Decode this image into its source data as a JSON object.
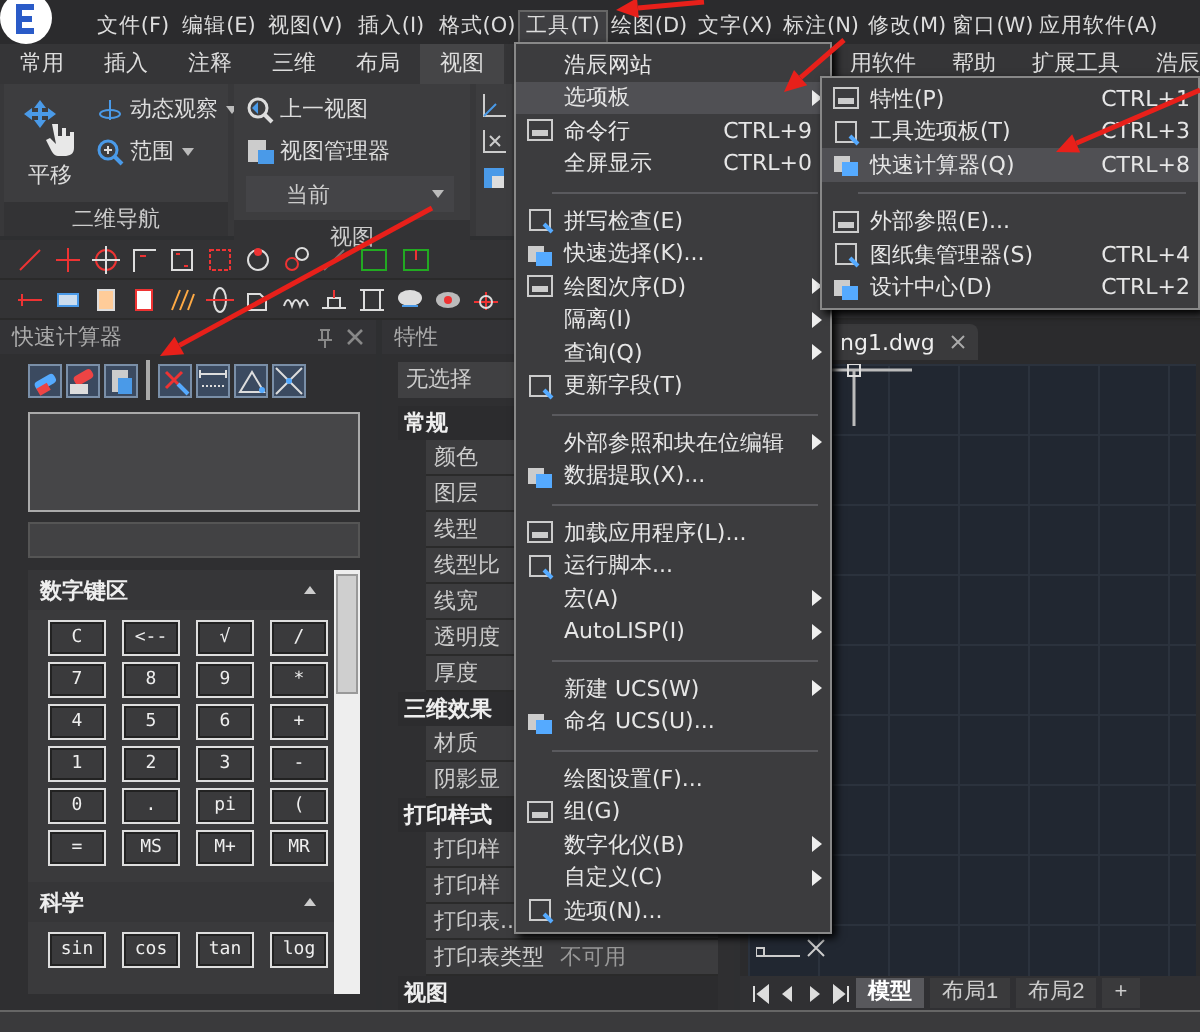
{
  "menubar": {
    "items": [
      {
        "label": "文件(F)",
        "selected": false
      },
      {
        "label": "编辑(E)",
        "selected": false
      },
      {
        "label": "视图(V)",
        "selected": false
      },
      {
        "label": "插入(I)",
        "selected": false
      },
      {
        "label": "格式(O)",
        "selected": false
      },
      {
        "label": "工具(T)",
        "selected": true
      },
      {
        "label": "绘图(D)",
        "selected": false
      },
      {
        "label": "文字(X)",
        "selected": false
      },
      {
        "label": "标注(N)",
        "selected": false
      },
      {
        "label": "修改(M)",
        "selected": false
      },
      {
        "label": "窗口(W)",
        "selected": false
      },
      {
        "label": "应用软件(A)",
        "selected": false
      }
    ]
  },
  "ribbon": {
    "tabs": [
      {
        "label": "常用",
        "selected": false
      },
      {
        "label": "插入",
        "selected": false
      },
      {
        "label": "注释",
        "selected": false
      },
      {
        "label": "三维",
        "selected": false
      },
      {
        "label": "布局",
        "selected": false
      },
      {
        "label": "视图",
        "selected": true
      }
    ],
    "tabs_right": [
      {
        "label": "用软件",
        "selected": false
      },
      {
        "label": "帮助",
        "selected": false
      },
      {
        "label": "扩展工具",
        "selected": false
      },
      {
        "label": "浩辰",
        "selected": false
      }
    ],
    "nav_group": {
      "title": "二维导航",
      "pan": "平移",
      "orbit": "动态观察",
      "extents": "范围"
    },
    "view_group": {
      "title": "视图",
      "previous": "上一视图",
      "manager": "视图管理器",
      "view_select": "当前"
    }
  },
  "calculator": {
    "title": "快速计算器",
    "keypad": {
      "title": "数字键区",
      "keys": [
        "C",
        "<--",
        "√",
        "/",
        "7",
        "8",
        "9",
        "*",
        "4",
        "5",
        "6",
        "+",
        "1",
        "2",
        "3",
        "-",
        "0",
        ".",
        "pi",
        "(",
        "=",
        "MS",
        "M+",
        "MR"
      ]
    },
    "scientific": {
      "title": "科学",
      "keys": [
        "sin",
        "cos",
        "tan",
        "log"
      ]
    }
  },
  "properties": {
    "title": "特性",
    "selection": "无选择",
    "sections": [
      {
        "title": "常规",
        "items": [
          {
            "label": "颜色"
          },
          {
            "label": "图层"
          },
          {
            "label": "线型"
          },
          {
            "label": "线型比"
          },
          {
            "label": "线宽"
          },
          {
            "label": "透明度"
          },
          {
            "label": "厚度"
          }
        ]
      },
      {
        "title": "三维效果",
        "items": [
          {
            "label": "材质"
          },
          {
            "label": "阴影显"
          }
        ]
      },
      {
        "title": "打印样式",
        "items": [
          {
            "label": "打印样"
          },
          {
            "label": "打印样"
          },
          {
            "label": "打印表.."
          },
          {
            "label": "打印表类型",
            "value": "不可用"
          }
        ]
      },
      {
        "title": "视图"
      }
    ]
  },
  "drawing": {
    "file_tab": "ng1.dwg",
    "layout_tabs": [
      {
        "label": "模型",
        "selected": true
      },
      {
        "label": "布局1",
        "selected": false
      },
      {
        "label": "布局2",
        "selected": false
      },
      {
        "label": "+",
        "selected": false
      }
    ]
  },
  "tools_menu": {
    "items": [
      {
        "kind": "item",
        "label": "浩辰网站",
        "submenu": false,
        "selected": false
      },
      {
        "kind": "item",
        "label": "选项板",
        "submenu": true,
        "selected": true
      },
      {
        "kind": "icon-item",
        "label": "命令行",
        "shortcut": "CTRL+9",
        "submenu": false,
        "selected": false
      },
      {
        "kind": "item",
        "label": "全屏显示",
        "shortcut": "CTRL+0",
        "submenu": false,
        "selected": false
      },
      {
        "kind": "separator"
      },
      {
        "kind": "icon-item",
        "label": "拼写检查(E)",
        "submenu": false,
        "selected": false
      },
      {
        "kind": "icon-item",
        "label": "快速选择(K)...",
        "submenu": false,
        "selected": false
      },
      {
        "kind": "icon-item",
        "label": "绘图次序(D)",
        "submenu": true,
        "selected": false
      },
      {
        "kind": "item",
        "label": "隔离(I)",
        "submenu": true,
        "selected": false
      },
      {
        "kind": "item",
        "label": "查询(Q)",
        "submenu": true,
        "selected": false
      },
      {
        "kind": "icon-item",
        "label": "更新字段(T)",
        "submenu": false,
        "selected": false
      },
      {
        "kind": "separator"
      },
      {
        "kind": "item",
        "label": "外部参照和块在位编辑",
        "submenu": true,
        "selected": false
      },
      {
        "kind": "icon-item",
        "label": "数据提取(X)...",
        "submenu": false,
        "selected": false
      },
      {
        "kind": "separator"
      },
      {
        "kind": "icon-item",
        "label": "加载应用程序(L)...",
        "submenu": false,
        "selected": false
      },
      {
        "kind": "icon-item",
        "label": "运行脚本...",
        "submenu": false,
        "selected": false
      },
      {
        "kind": "item",
        "label": "宏(A)",
        "submenu": true,
        "selected": false
      },
      {
        "kind": "item",
        "label": "AutoLISP(I)",
        "submenu": true,
        "selected": false
      },
      {
        "kind": "separator"
      },
      {
        "kind": "item",
        "label": "新建 UCS(W)",
        "submenu": true,
        "selected": false
      },
      {
        "kind": "icon-item",
        "label": "命名 UCS(U)...",
        "submenu": false,
        "selected": false
      },
      {
        "kind": "separator"
      },
      {
        "kind": "item",
        "label": "绘图设置(F)...",
        "submenu": false,
        "selected": false
      },
      {
        "kind": "icon-item",
        "label": "组(G)",
        "submenu": false,
        "selected": false
      },
      {
        "kind": "item",
        "label": "数字化仪(B)",
        "submenu": true,
        "selected": false
      },
      {
        "kind": "item",
        "label": "自定义(C)",
        "submenu": true,
        "selected": false
      },
      {
        "kind": "icon-item",
        "label": "选项(N)...",
        "submenu": false,
        "selected": false
      }
    ]
  },
  "palettes_submenu": {
    "items": [
      {
        "kind": "icon-item",
        "label": "特性(P)",
        "shortcut": "CTRL+1",
        "selected": false
      },
      {
        "kind": "icon-item",
        "label": "工具选项板(T)",
        "shortcut": "CTRL+3",
        "selected": false
      },
      {
        "kind": "icon-item",
        "label": "快速计算器(Q)",
        "shortcut": "CTRL+8",
        "selected": true
      },
      {
        "kind": "separator"
      },
      {
        "kind": "icon-item",
        "label": "外部参照(E)...",
        "selected": false
      },
      {
        "kind": "icon-item",
        "label": "图纸集管理器(S)",
        "shortcut": "CTRL+4",
        "selected": false
      },
      {
        "kind": "icon-item",
        "label": "设计中心(D)",
        "shortcut": "CTRL+2",
        "selected": false
      }
    ]
  }
}
